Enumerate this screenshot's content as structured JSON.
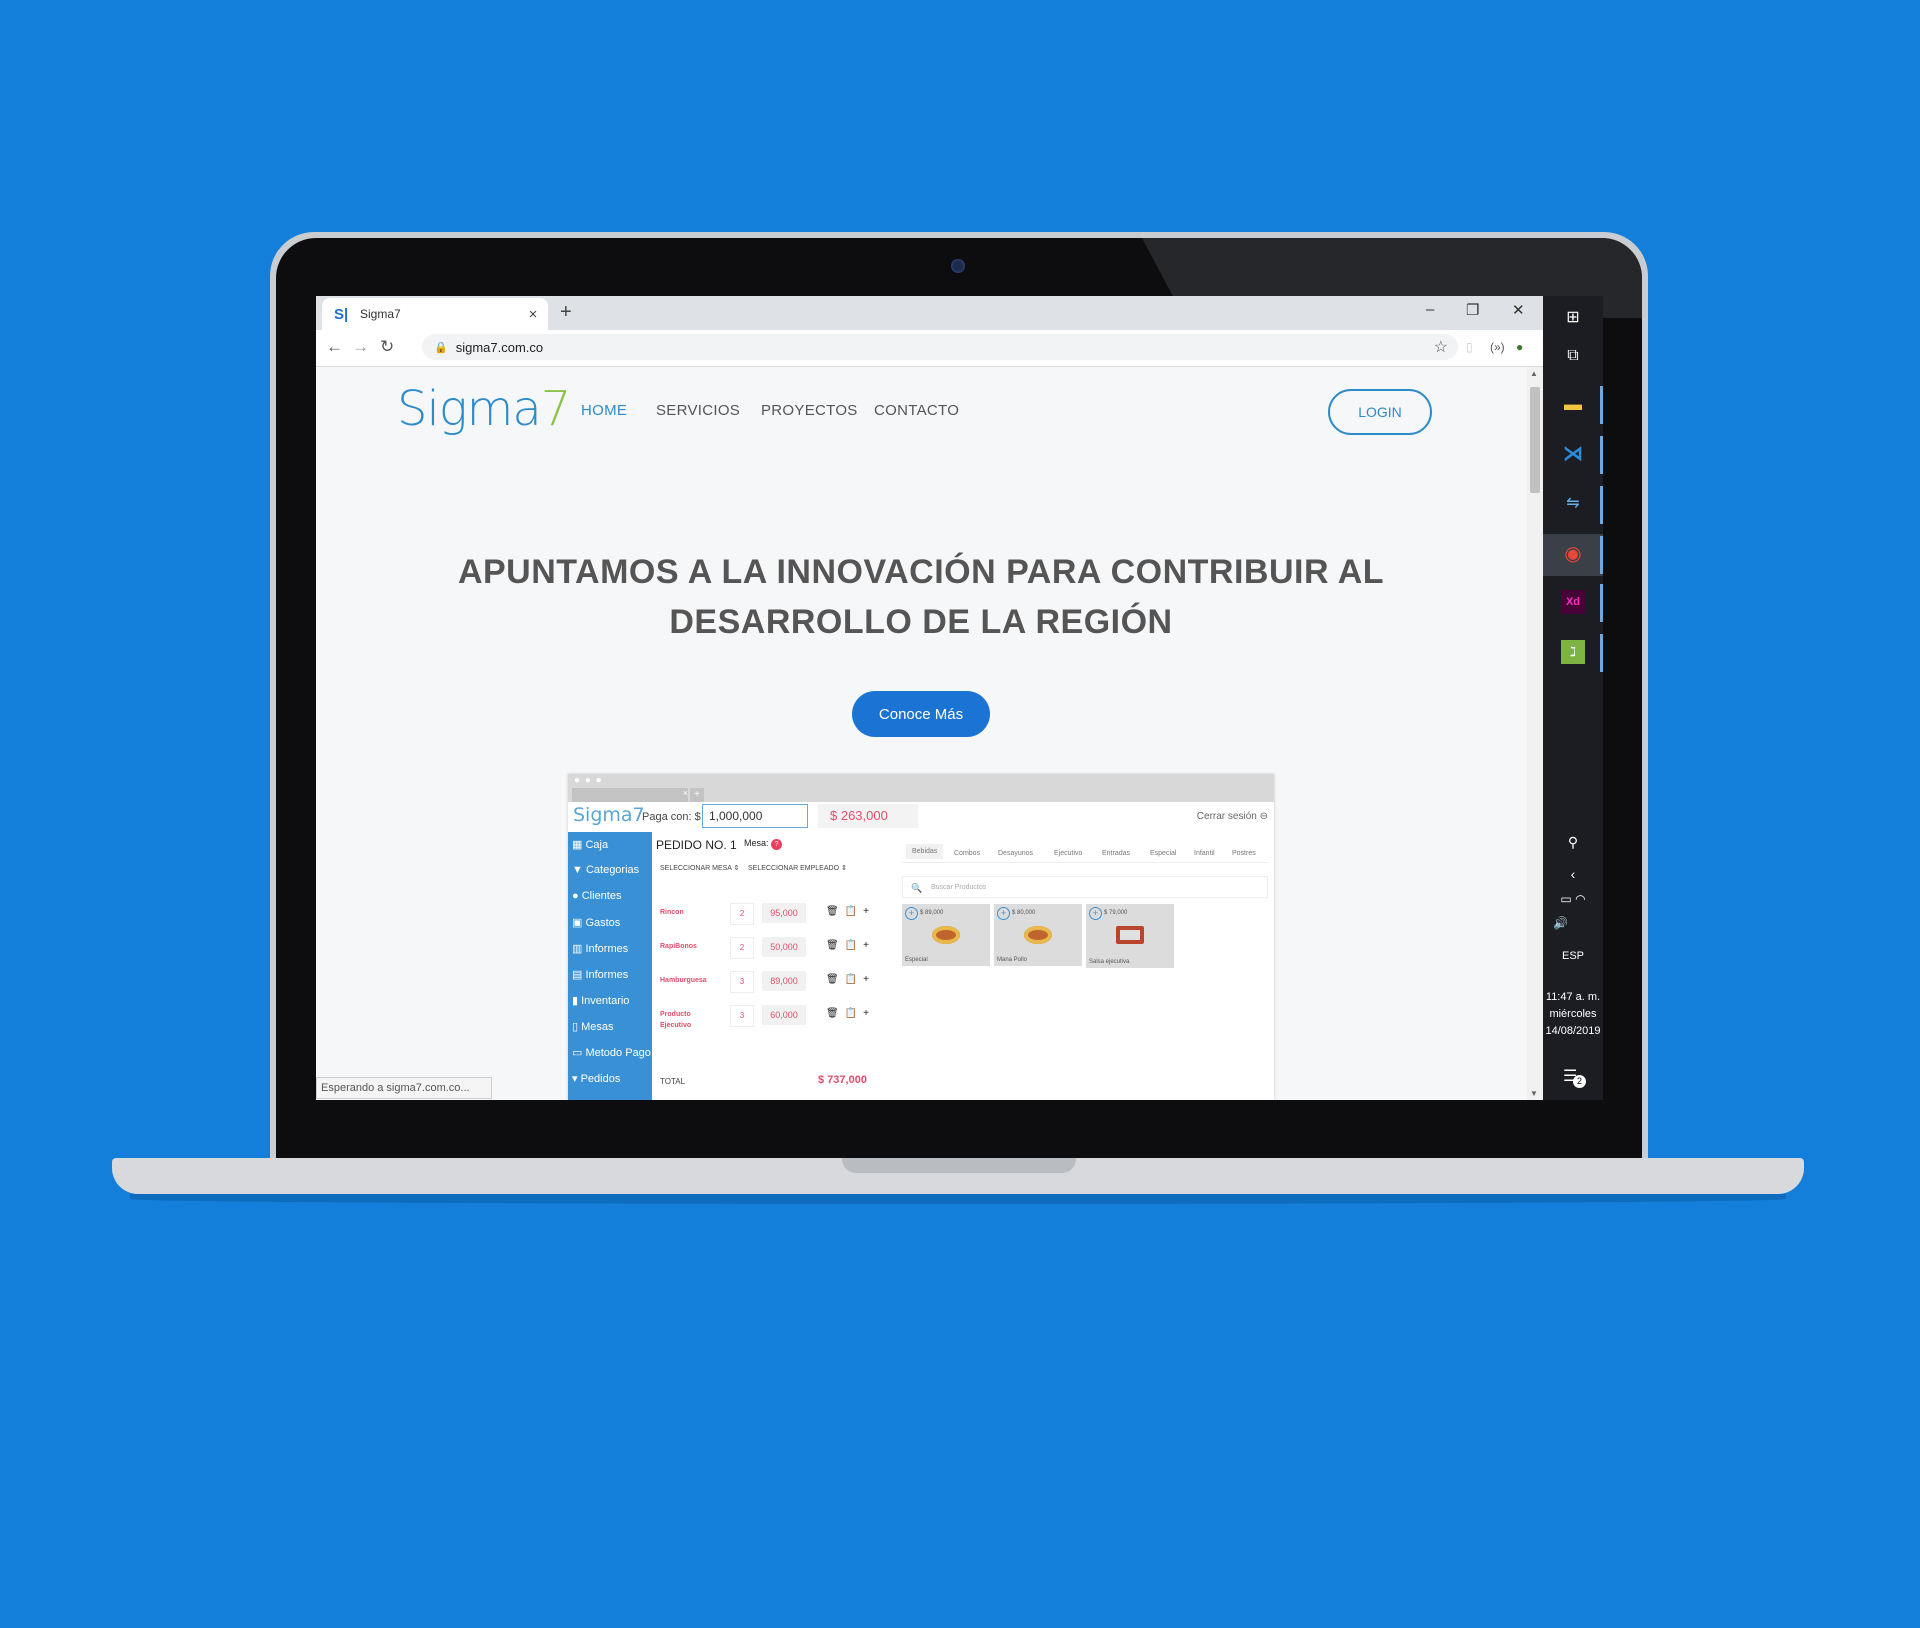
{
  "browser": {
    "tab_favicon": "S|",
    "tab_title": "Sigma7",
    "tab_close": "×",
    "new_tab": "+",
    "minimize": "–",
    "restore": "❐",
    "close": "✕",
    "back": "←",
    "forward": "→",
    "reload": "↻",
    "url": "sigma7.com.co",
    "star": "☆",
    "menu": "⋮",
    "status_text": "Esperando a sigma7.com.co..."
  },
  "site": {
    "logo_text": "Sigma",
    "logo_digit": "7",
    "nav": [
      "HOME",
      "SERVICIOS",
      "PROYECTOS",
      "CONTACTO"
    ],
    "login_label": "LOGIN",
    "hero_line1": "APUNTAMOS A LA INNOVACIÓN PARA CONTRIBUIR AL",
    "hero_line2": "DESARROLLO DE LA REGIÓN",
    "cta_label": "Conoce Más"
  },
  "mockup": {
    "logo": "Sigma7",
    "pay_label": "Paga con: $",
    "pay_value": "1,000,000",
    "change_value": "$ 263,000",
    "logout": "Cerrar sesión",
    "sidebar": [
      "Caja",
      "Categorias",
      "Clientes",
      "Gastos",
      "Informes",
      "Informes",
      "Inventario",
      "Mesas",
      "Metodo Pago",
      "Pedidos"
    ],
    "order_title": "PEDIDO NO. 1",
    "mesa_label": "Mesa:",
    "mesa_badge": "?",
    "select_mesa": "SELECCIONAR MESA ⇕",
    "select_empleado": "SELECCIONAR EMPLEADO ⇕",
    "rows": [
      {
        "name": "Rincon",
        "qty": "2",
        "price": "95,000"
      },
      {
        "name": "RapiBonos",
        "qty": "2",
        "price": "50,000"
      },
      {
        "name": "Hamburguesa",
        "qty": "3",
        "price": "89,000"
      },
      {
        "name": "Producto Ejecutivo",
        "qty": "3",
        "price": "60,000"
      }
    ],
    "row_actions": "🗑📋+",
    "total_label": "TOTAL",
    "total_value": "$ 737,000",
    "categories": [
      "Bebidas",
      "Combos",
      "Desayunos",
      "Ejecutivo",
      "Entradas",
      "Especial",
      "Infantil",
      "Postres"
    ],
    "search_placeholder": "Buscar Productos",
    "products": [
      {
        "price": "$ 89,000",
        "name": "Especial"
      },
      {
        "price": "$ 80,000",
        "name": "Mana Pollo"
      },
      {
        "price": "$ 79,000",
        "name": "Salsa ejecutiva"
      }
    ]
  },
  "taskbar": {
    "language": "ESP",
    "time": "11:47 a. m.",
    "day": "miércoles",
    "date": "14/08/2019",
    "notifications": "2"
  }
}
